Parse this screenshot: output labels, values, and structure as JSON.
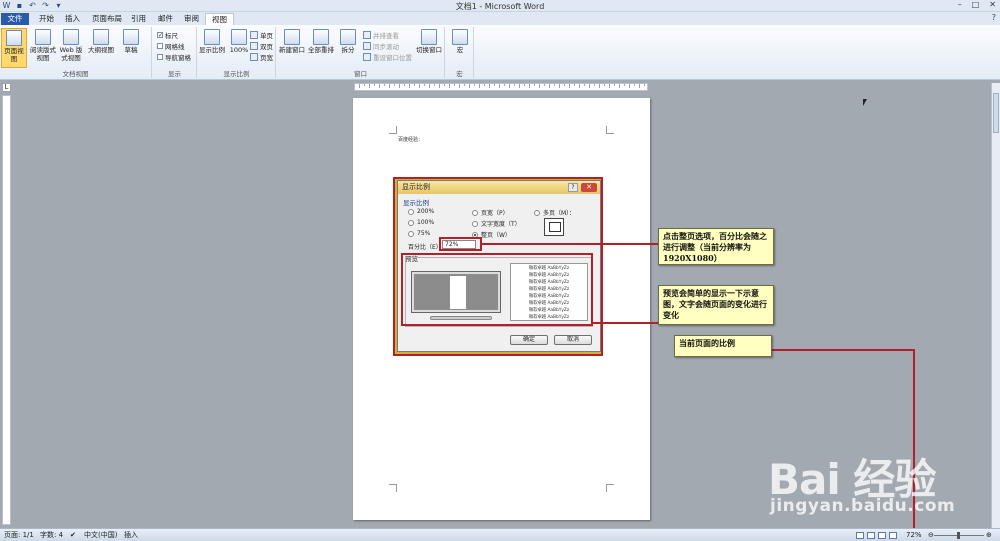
{
  "window": {
    "title": "文档1 - Microsoft Word",
    "controls": [
      "–",
      "□",
      "✕"
    ]
  },
  "tabs": [
    {
      "label": "文件"
    },
    {
      "label": "开始"
    },
    {
      "label": "插入"
    },
    {
      "label": "页面布局"
    },
    {
      "label": "引用"
    },
    {
      "label": "邮件"
    },
    {
      "label": "审阅"
    },
    {
      "label": "视图"
    }
  ],
  "ribbon": {
    "doc_views": {
      "label": "文档视图",
      "buttons": [
        "页面视图",
        "阅读版式视图",
        "Web 版式视图",
        "大纲视图",
        "草稿"
      ]
    },
    "show": {
      "label": "显示",
      "items": [
        {
          "label": "标尺",
          "checked": true
        },
        {
          "label": "网格线",
          "checked": false
        },
        {
          "label": "导航窗格",
          "checked": false
        }
      ]
    },
    "zoom": {
      "label": "显示比例",
      "buttons": [
        "显示比例",
        "100%"
      ],
      "small": [
        "单页",
        "双页",
        "页宽"
      ]
    },
    "window": {
      "label": "窗口",
      "buttons": [
        "新建窗口",
        "全部重排",
        "拆分"
      ],
      "small": [
        "并排查看",
        "同步滚动",
        "重设窗口位置"
      ],
      "switch": "切换窗口"
    },
    "macro": {
      "label": "宏",
      "button": "宏"
    }
  },
  "document": {
    "line": "百度经验："
  },
  "dialog": {
    "title": "显示比例",
    "help": "?",
    "close": "✕",
    "group_label": "显示比例",
    "options_left": [
      "200%",
      "100%",
      "75%"
    ],
    "options_mid": [
      "页宽（P）",
      "文字宽度（T）",
      "整页（W）"
    ],
    "option_right": "多页（M）：",
    "selected": "整页（W）",
    "percent_label": "百分比（E）：",
    "percent_value": "72%",
    "preview_label": "预览",
    "preview_text": [
      "微软卓越 AaBbYyZz",
      "微软卓越 AaBbYyZz",
      "微软卓越 AaBbYyZz",
      "微软卓越 AaBbYyZz",
      "微软卓越 AaBbYyZz",
      "微软卓越 AaBbYyZz",
      "微软卓越 AaBbYyZz",
      "微软卓越 AaBbYyZz"
    ],
    "ok": "确定",
    "cancel": "取消"
  },
  "callouts": {
    "one": "点击整页选项，百分比会随之进行调整（当前分辨率为1920X1080）",
    "two": "预览会简单的显示一下示意图，文字会随页面的变化进行变化",
    "three": "当前页面的比例"
  },
  "status": {
    "page": "页面: 1/1",
    "words": "字数: 4",
    "lang": "中文(中国)",
    "mode": "插入",
    "zoom": "72%"
  },
  "watermark": {
    "logo": "Bai 经验",
    "url": "jingyan.baidu.com"
  },
  "colors": {
    "annotation_red": "#b3202a",
    "callout_bg": "#ffffbf",
    "file_tab": "#2a5ba8"
  }
}
